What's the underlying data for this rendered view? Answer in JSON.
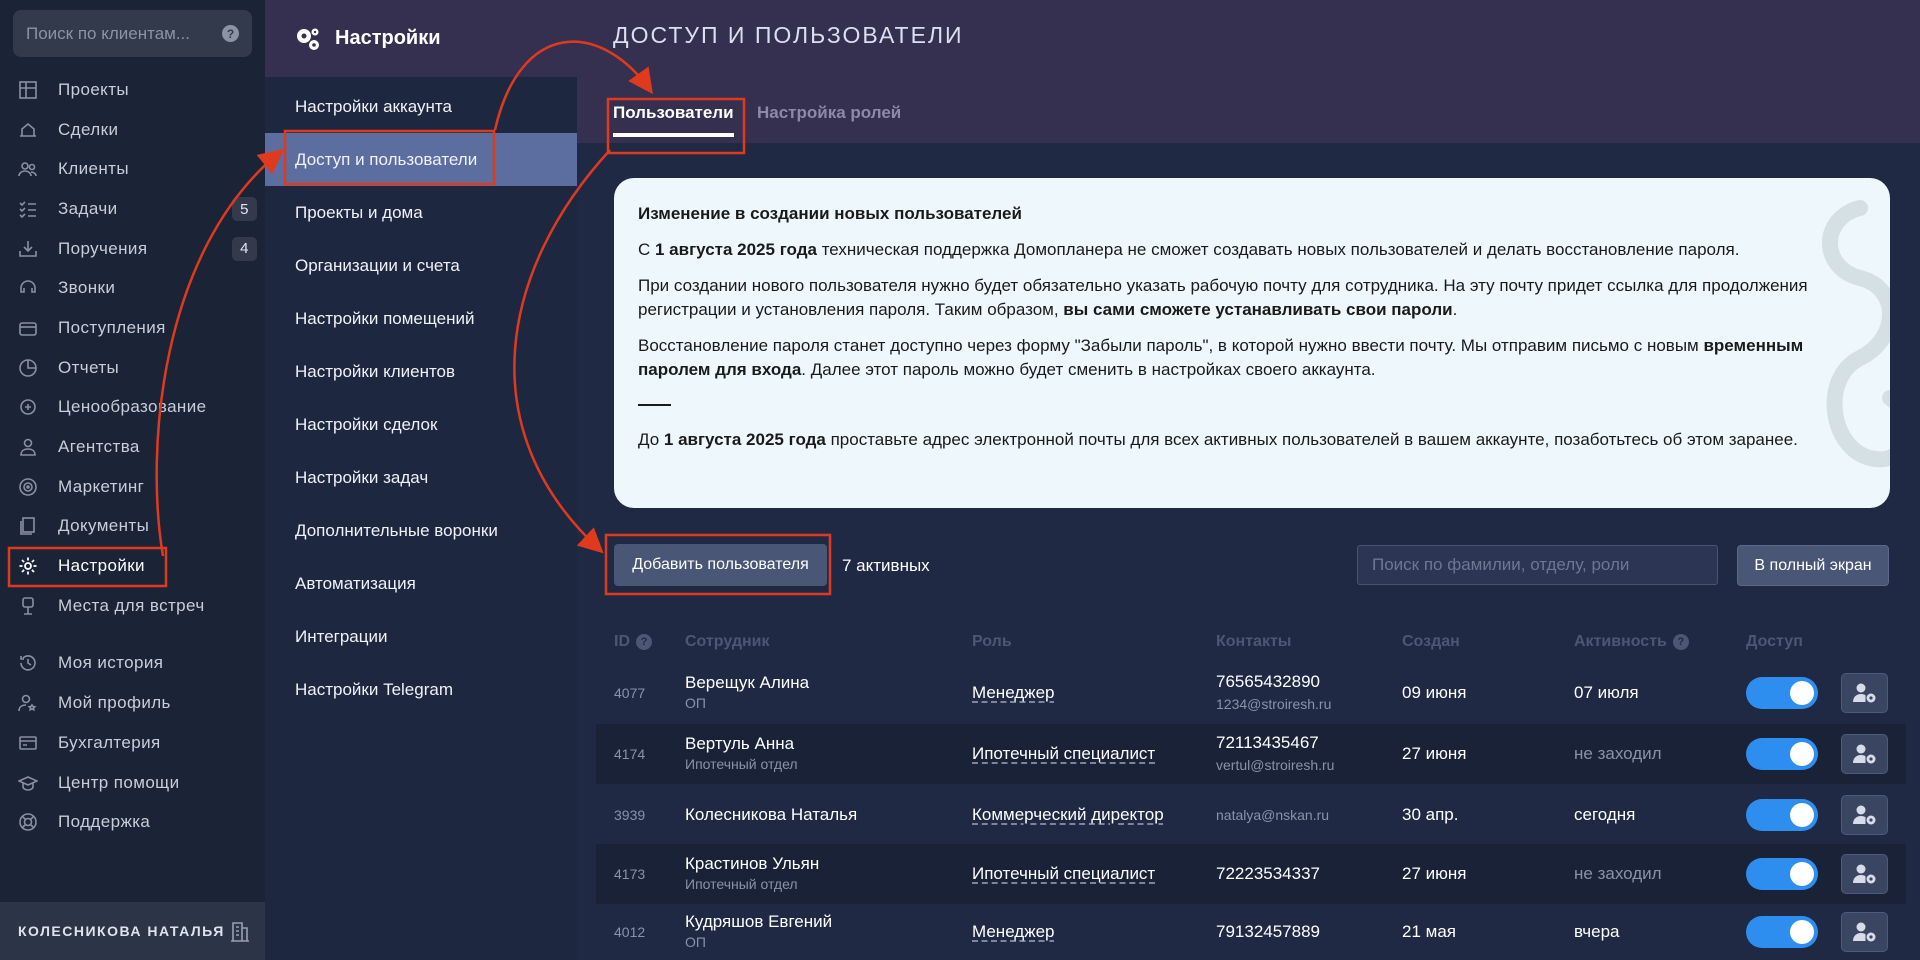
{
  "sidebar": {
    "search_placeholder": "Поиск по клиентам...",
    "items": [
      {
        "label": "Проекты",
        "icon": "projects-icon"
      },
      {
        "label": "Сделки",
        "icon": "deals-icon"
      },
      {
        "label": "Клиенты",
        "icon": "clients-icon"
      },
      {
        "label": "Задачи",
        "icon": "tasks-icon",
        "badge": "5"
      },
      {
        "label": "Поручения",
        "icon": "assignments-icon",
        "badge": "4"
      },
      {
        "label": "Звонки",
        "icon": "calls-icon"
      },
      {
        "label": "Поступления",
        "icon": "income-icon"
      },
      {
        "label": "Отчеты",
        "icon": "reports-icon"
      },
      {
        "label": "Ценообразование",
        "icon": "pricing-icon"
      },
      {
        "label": "Агентства",
        "icon": "agencies-icon"
      },
      {
        "label": "Маркетинг",
        "icon": "marketing-icon"
      },
      {
        "label": "Документы",
        "icon": "documents-icon"
      },
      {
        "label": "Настройки",
        "icon": "gear-icon"
      },
      {
        "label": "Места для встреч",
        "icon": "meeting-places-icon"
      },
      {
        "label": "Моя история",
        "icon": "history-icon"
      },
      {
        "label": "Мой профиль",
        "icon": "profile-icon"
      },
      {
        "label": "Бухгалтерия",
        "icon": "accounting-icon"
      },
      {
        "label": "Центр помощи",
        "icon": "help-center-icon"
      },
      {
        "label": "Поддержка",
        "icon": "support-icon"
      }
    ],
    "user_name": "КОЛЕСНИКОВА НАТАЛЬЯ"
  },
  "settings": {
    "title": "Настройки",
    "items": [
      "Настройки аккаунта",
      "Доступ и пользователи",
      "Проекты и дома",
      "Организации и счета",
      "Настройки помещений",
      "Настройки клиентов",
      "Настройки сделок",
      "Настройки задач",
      "Дополнительные воронки",
      "Автоматизация",
      "Интеграции",
      "Настройки Telegram"
    ]
  },
  "main": {
    "title": "ДОСТУП И ПОЛЬЗОВАТЕЛИ",
    "tabs": {
      "users": "Пользователи",
      "roles": "Настройка ролей"
    },
    "notice": {
      "title": "Изменение в создании новых пользователей",
      "p1_pre": "С ",
      "p1_bold": "1 августа 2025 года",
      "p1_post": " техническая поддержка Домопланера не сможет создавать новых пользователей и делать восстановление пароля.",
      "p2_pre": "При создании нового пользователя нужно будет обязательно указать рабочую почту для сотрудника. На эту почту придет ссылка для продолжения регистрации и установления пароля. Таким образом, ",
      "p2_bold": "вы сами сможете устанавливать свои пароли",
      "p2_post": ".",
      "p3_pre": "Восстановление пароля станет доступно через форму \"Забыли пароль\", в которой нужно ввести почту. Мы отправим письмо с новым ",
      "p3_bold": "временным паролем для входа",
      "p3_post": ". Далее этот пароль можно будет сменить в настройках своего аккаунта.",
      "p4_pre": "До ",
      "p4_bold": "1 августа 2025 года",
      "p4_post": " проставьте адрес электронной почты для всех активных пользователей в вашем аккаунте, позаботьтесь об этом заранее."
    },
    "add_user_label": "Добавить пользователя",
    "active_count": "7 активных",
    "table_search_placeholder": "Поиск по фамилии, отделу, роли",
    "fullscreen_label": "В полный экран",
    "columns": {
      "id": "ID",
      "employee": "Сотрудник",
      "role": "Роль",
      "contacts": "Контакты",
      "created": "Создан",
      "activity": "Активность",
      "access": "Доступ"
    },
    "rows": [
      {
        "id": "4077",
        "name": "Верещук Алина",
        "dept": "ОП",
        "role": "Менеджер",
        "phone": "76565432890",
        "email": "1234@stroiresh.ru",
        "created": "09 июня",
        "activity": "07 июля",
        "access": true
      },
      {
        "id": "4174",
        "name": "Вертуль Анна",
        "dept": "Ипотечный отдел",
        "role": "Ипотечный специалист",
        "phone": "72113435467",
        "email": "vertul@stroiresh.ru",
        "created": "27 июня",
        "activity": "не заходил",
        "access": true
      },
      {
        "id": "3939",
        "name": "Колесникова Наталья",
        "dept": "",
        "role": "Коммерческий директор",
        "phone": "",
        "email": "natalya@nskan.ru",
        "created": "30 апр.",
        "activity": "сегодня",
        "access": true
      },
      {
        "id": "4173",
        "name": "Крастинов Ульян",
        "dept": "Ипотечный отдел",
        "role": "Ипотечный специалист",
        "phone": "72223534337",
        "email": "",
        "created": "27 июня",
        "activity": "не заходил",
        "access": true
      },
      {
        "id": "4012",
        "name": "Кудряшов Евгений",
        "dept": "ОП",
        "role": "Менеджер",
        "phone": "79132457889",
        "email": "",
        "created": "21 мая",
        "activity": "вчера",
        "access": true
      }
    ]
  },
  "colors": {
    "sidebar_bg": "#1b2336",
    "header_bg": "#35304f",
    "active_item": "#5b6e9f",
    "toggle_on": "#2e8ef0",
    "annotation": "#e03a1e"
  }
}
